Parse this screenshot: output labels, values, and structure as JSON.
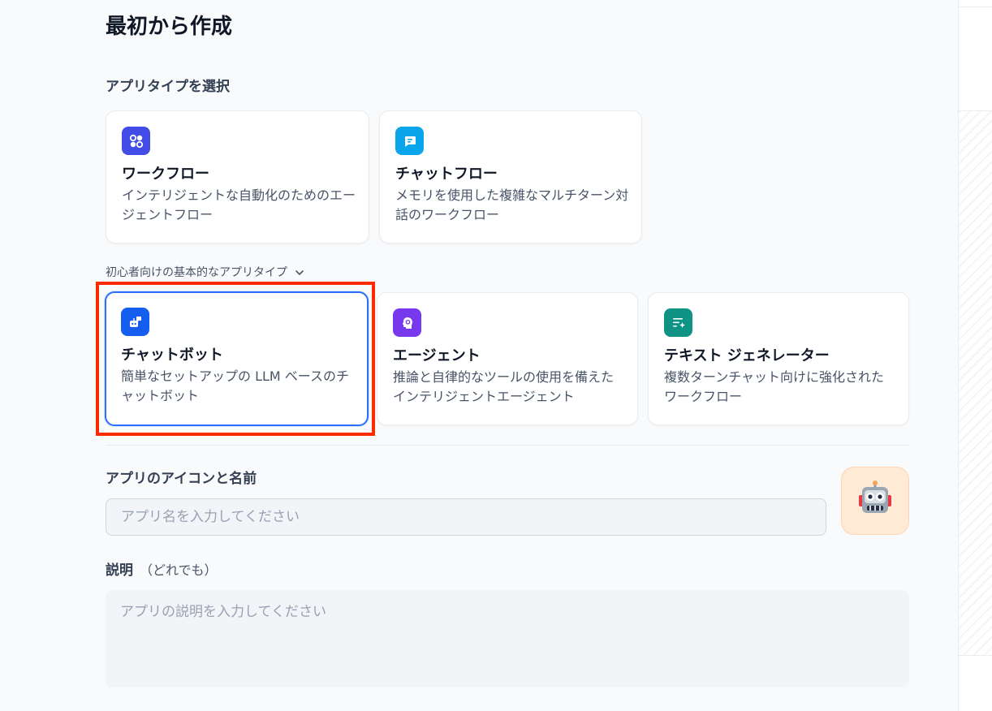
{
  "page": {
    "title": "最初から作成"
  },
  "app_type": {
    "label": "アプリタイプを選択",
    "primary_cards": [
      {
        "title": "ワークフロー",
        "description": "インテリジェントな自動化のためのエージェントフロー",
        "icon": "workflow-icon",
        "color": "#444ce7"
      },
      {
        "title": "チャットフロー",
        "description": "メモリを使用した複雑なマルチターン対話のワークフロー",
        "icon": "chatflow-icon",
        "color": "#0ba5ec"
      }
    ],
    "beginner_toggle": "初心者向けの基本的なアプリタイプ",
    "beginner_cards": [
      {
        "title": "チャットボット",
        "description": "簡単なセットアップの LLM ベースのチャットボット",
        "icon": "chatbot-icon",
        "color": "#155eef",
        "selected": true
      },
      {
        "title": "エージェント",
        "description": "推論と自律的なツールの使用を備えたインテリジェントエージェント",
        "icon": "agent-icon",
        "color": "#7839ee"
      },
      {
        "title": "テキスト ジェネレーター",
        "description": "複数ターンチャット向けに強化されたワークフロー",
        "icon": "text-generator-icon",
        "color": "#0e9384"
      }
    ]
  },
  "name_section": {
    "label": "アプリのアイコンと名前",
    "placeholder": "アプリ名を入力してください",
    "value": "",
    "icon": "robot-emoji-icon",
    "icon_glyph": "🤖"
  },
  "description_section": {
    "label": "説明",
    "optional": "（どれでも）",
    "placeholder": "アプリの説明を入力してください",
    "value": ""
  },
  "colors": {
    "accent": "#2970ff",
    "highlight": "#ff2a00"
  }
}
